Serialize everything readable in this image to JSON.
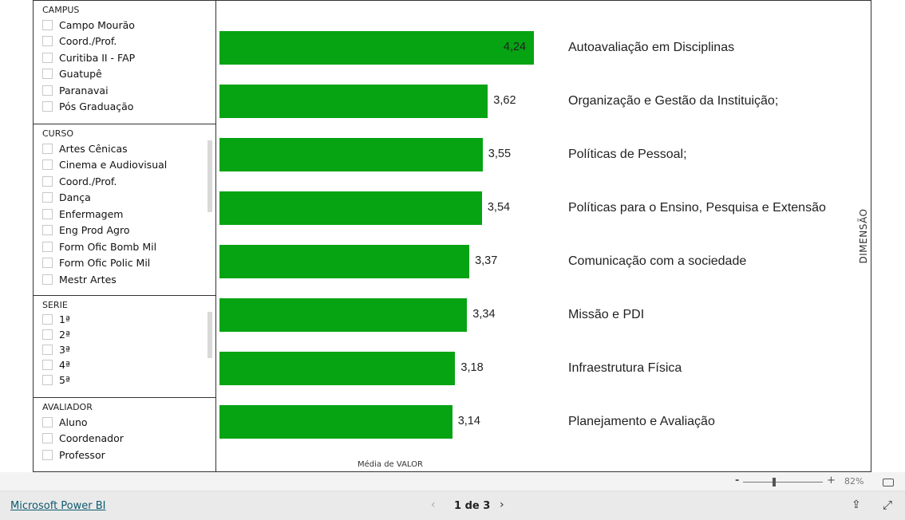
{
  "slicers": [
    {
      "title": "CAMPUS",
      "items": [
        "Campo Mourão",
        "Coord./Prof.",
        "Curitiba II - FAP",
        "Guatupê",
        "Paranavai",
        "Pós Graduação"
      ]
    },
    {
      "title": "CURSO",
      "items": [
        "Artes Cênicas",
        "Cinema e Audiovisual",
        "Coord./Prof.",
        "Dança",
        "Enfermagem",
        "Eng Prod Agro",
        "Form Ofic Bomb Mil",
        "Form Ofic Polic Mil",
        "Mestr Artes"
      ]
    },
    {
      "title": "SERIE",
      "items": [
        "1ª",
        "2ª",
        "3ª",
        "4ª",
        "5ª"
      ]
    },
    {
      "title": "AVALIADOR",
      "items": [
        "Aluno",
        "Coordenador",
        "Professor"
      ]
    }
  ],
  "chart_data": {
    "type": "bar",
    "orientation": "horizontal",
    "categories": [
      "Autoavaliação em Disciplinas",
      "Organização e Gestão da Instituição;",
      "Políticas de Pessoal;",
      "Políticas para o Ensino, Pesquisa e Extensão",
      "Comunicação com a sociedade",
      "Missão e PDI",
      "Infraestrutura Física",
      "Planejamento e Avaliação"
    ],
    "values": [
      4.24,
      3.62,
      3.55,
      3.54,
      3.37,
      3.34,
      3.18,
      3.14
    ],
    "labels": [
      "4,24",
      "3,62",
      "3,55",
      "3,54",
      "3,37",
      "3,34",
      "3,18",
      "3,14"
    ],
    "xlabel": "Média de VALOR",
    "ylabel": "DIMENSÃO",
    "color": "#06a313",
    "grid": false
  },
  "zoom": {
    "minus": "-",
    "plus": "+",
    "level": "82%",
    "value": 82
  },
  "footer": {
    "brand": "Microsoft Power BI",
    "page": "1 de 3"
  }
}
